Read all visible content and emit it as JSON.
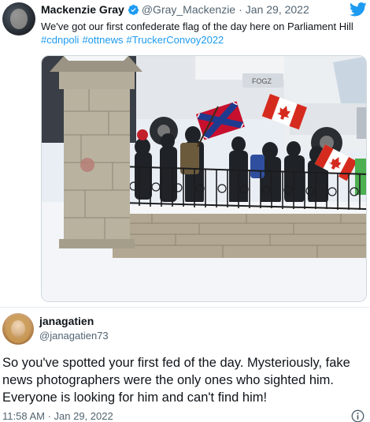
{
  "tweet": {
    "author_name": "Mackenzie Gray",
    "handle": "@Gray_Mackenzie",
    "separator": "·",
    "date": "Jan 29, 2022",
    "text": "We've got our first confederate flag of the day here on Parliament Hill",
    "hashtags": [
      "#cdnpoli",
      "#ottnews",
      "#TruckerConvoy2022"
    ],
    "truck_logo_text": "FOGZ"
  },
  "reply": {
    "author_name": "janagatien",
    "handle": "@janagatien73",
    "text": "So you've spotted your first fed of the day. Mysteriously, fake news photographers were the only ones who sighted him. Everyone is looking for him and can't find him!",
    "timestamp": "11:58 AM · Jan 29, 2022"
  },
  "colors": {
    "accent": "#1d9bf0",
    "secondary_text": "#536471",
    "primary_text": "#0f1419"
  },
  "icons": {
    "verified": "verified-badge-icon",
    "brand": "twitter-bird-icon",
    "info": "info-icon"
  }
}
